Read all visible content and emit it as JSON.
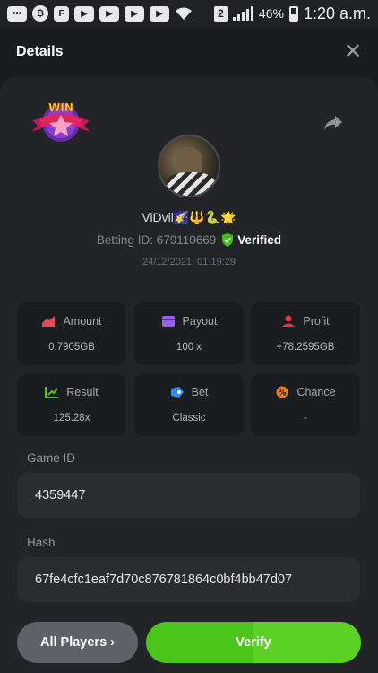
{
  "status_bar": {
    "time": "1:20 a.m.",
    "battery": "46%",
    "sim": "2",
    "icons": [
      "message-icon",
      "b-app-icon",
      "flipboard-icon",
      "youtube-icon",
      "youtube-icon",
      "youtube-icon",
      "youtube-icon",
      "wifi-icon"
    ]
  },
  "header": {
    "title": "Details",
    "close": "✕"
  },
  "player": {
    "badge": "WIN",
    "username": "ViDvil🌠🔱🐍🌟",
    "betting_label": "Betting ID: 679110669",
    "verified": "Verified",
    "datetime": "24/12/2021, 01:19:29"
  },
  "stats": [
    {
      "label": "Amount",
      "value": "0.7905GB",
      "color": "#e8475a",
      "icon": "amount-icon"
    },
    {
      "label": "Payout",
      "value": "100 x",
      "color": "#9b5cf0",
      "icon": "payout-icon"
    },
    {
      "label": "Profit",
      "value": "+78.2595GB",
      "color": "#e8353f",
      "icon": "profit-icon"
    },
    {
      "label": "Result",
      "value": "125.28x",
      "color": "#59c12a",
      "icon": "result-icon"
    },
    {
      "label": "Bet",
      "value": "Classic",
      "color": "#2f8cf2",
      "icon": "bet-icon"
    },
    {
      "label": "Chance",
      "value": "-",
      "color": "#f07a1e",
      "icon": "chance-icon"
    }
  ],
  "game": {
    "label": "Game ID",
    "value": "4359447"
  },
  "hash": {
    "label": "Hash",
    "value": "67fe4cfc1eaf7d70c876781864c0bf4bb47d07"
  },
  "buttons": {
    "players": "All Players ›",
    "verify": "Verify"
  },
  "colors": {
    "accent": "#4cc51a",
    "background": "#1b1c1f",
    "card": "#232427"
  }
}
